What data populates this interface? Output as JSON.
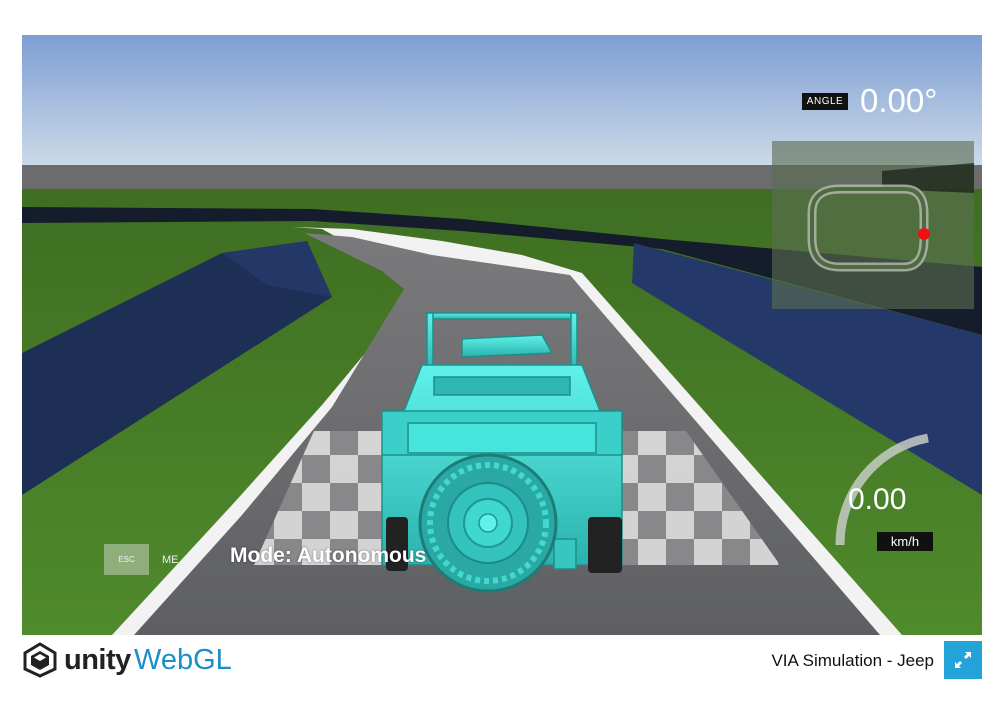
{
  "hud": {
    "angle_tag": "ANGLE",
    "angle_value": "0.00°",
    "speed_value": "0.00",
    "speed_unit": "km/h",
    "esc_key": "ESC",
    "menu_label": "ME",
    "mode_label": "Mode: Autonomous"
  },
  "footer": {
    "unity_word": "unity",
    "webgl_word": "WebGL",
    "build_title": "VIA Simulation - Jeep"
  },
  "colors": {
    "brand_blue": "#24a3d8",
    "jeep_cyan": "#3fd8d0",
    "grass": "#4a7a28",
    "road": "#6a6a6c",
    "barrier": "#1d2d4f"
  }
}
